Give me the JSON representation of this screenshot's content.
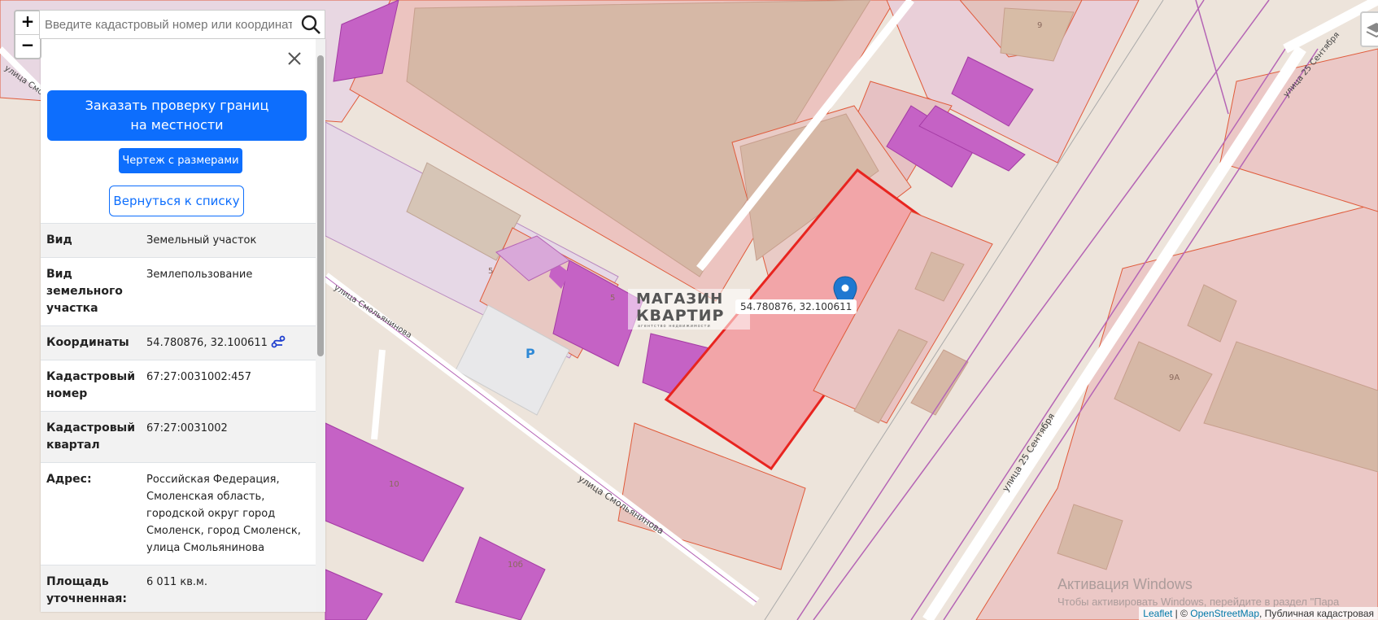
{
  "search": {
    "placeholder": "Введите кадастровый номер или координаты"
  },
  "zoom": {
    "in_label": "+",
    "out_label": "−"
  },
  "panel": {
    "order_button": "Заказать проверку границ на местности",
    "drawing_button": "Чертеж с размерами",
    "back_button": "Вернуться к списку",
    "rows": [
      {
        "key": "Вид",
        "value": "Земельный участок"
      },
      {
        "key": "Вид земельного участка",
        "value": "Землепользование"
      },
      {
        "key": "Координаты",
        "value": "54.780876, 32.100611"
      },
      {
        "key": "Кадастровый номер",
        "value": "67:27:0031002:457"
      },
      {
        "key": "Кадастровый квартал",
        "value": "67:27:0031002"
      },
      {
        "key": "Адрес:",
        "value": "Российская Федерация, Смоленская область, городской округ город Смоленск, город Смоленск, улица Смольянинова"
      },
      {
        "key": "Площадь уточненная:",
        "value": "6 011 кв.м."
      }
    ]
  },
  "map": {
    "coord_tooltip": "54.780876, 32.100611",
    "street_labels": [
      "улица Смольянинова",
      "улица Смольянинова",
      "улица 25 Сентября",
      "улица 25 Сентября",
      "улица Смольянинова"
    ],
    "house_numbers": [
      "9",
      "5",
      "5",
      "10",
      "10б",
      "9А"
    ],
    "parking": "P",
    "logo_line1": "МАГАЗИН",
    "logo_line2": "КВАРТИР",
    "logo_line3": "агентство недвижимости"
  },
  "attribution": {
    "leaflet": "Leaflet",
    "sep": " | © ",
    "osm": "OpenStreetMap",
    "rest": ", Публичная кадастровая"
  },
  "watermark": {
    "line1": "Активация Windows",
    "line2": "Чтобы активировать Windows, перейдите в раздел \"Пара"
  }
}
